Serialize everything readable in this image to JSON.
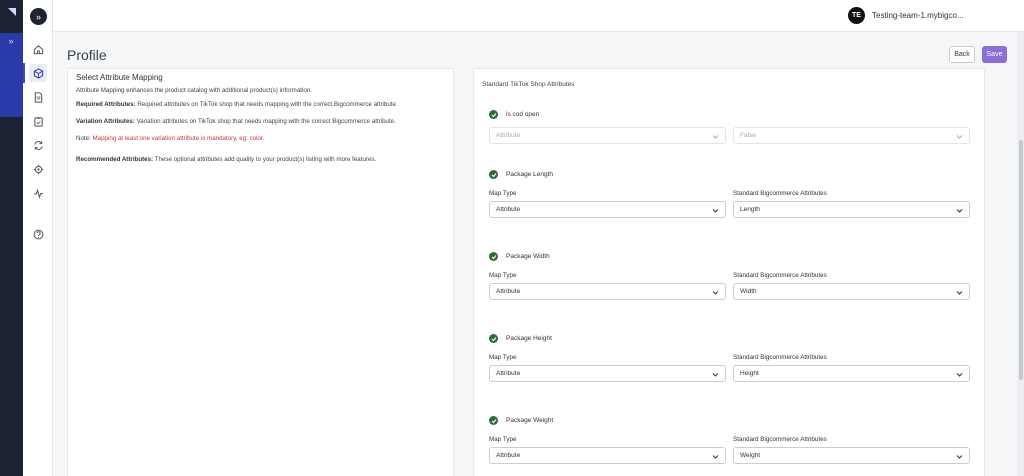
{
  "topbar": {
    "avatar_initials": "TE",
    "store_name": "Testing-team-1.mybigco..."
  },
  "page": {
    "title": "Profile",
    "back_label": "Back",
    "save_label": "Save"
  },
  "info": {
    "heading": "Select Attribute Mapping",
    "intro": "Attribute Mapping enhances the product catalog with additional product(s) information.",
    "required_title": "Required Attributes:",
    "required_text": " Required attributes on TikTok shop that needs mapping with the correct Bigcommerce attribute.",
    "variation_title": "Variation Attributes:",
    "variation_text": " Variation attributes on TikTok shop that needs mapping with the correct Bigcommerce attribute.",
    "note_label": "Note:",
    "note_text": " Mapping at least one variation attribute is mandatory, eg: color.",
    "recommended_title": "Recommended Attributes:",
    "recommended_text": " These optional attributes add quality to your product(s) listing with more features."
  },
  "form": {
    "title": "Standard TikTok Shop Attributes",
    "map_type_label": "Map Type",
    "standard_label": "Standard Bigcommerce Attributes",
    "attributes": [
      {
        "name": "is cod open",
        "map_type": "Attribute",
        "value": "False"
      },
      {
        "name": "Package Length",
        "map_type": "Attribute",
        "value": "Length"
      },
      {
        "name": "Package Width",
        "map_type": "Attribute",
        "value": "Width"
      },
      {
        "name": "Package Height",
        "map_type": "Attribute",
        "value": "Height"
      },
      {
        "name": "Package Weight",
        "map_type": "Attribute",
        "value": "Weight"
      }
    ]
  },
  "colors": {
    "rail": "#1d2235",
    "rail_accent": "#2a3aa8",
    "save_button": "#8a6fd6",
    "check": "#2f6b3a",
    "note": "#c7383a"
  },
  "sidebar_icons": [
    "home-icon",
    "cube-icon",
    "document-icon",
    "clipboard-icon",
    "sync-icon",
    "gear-icon",
    "activity-icon",
    "help-icon"
  ]
}
